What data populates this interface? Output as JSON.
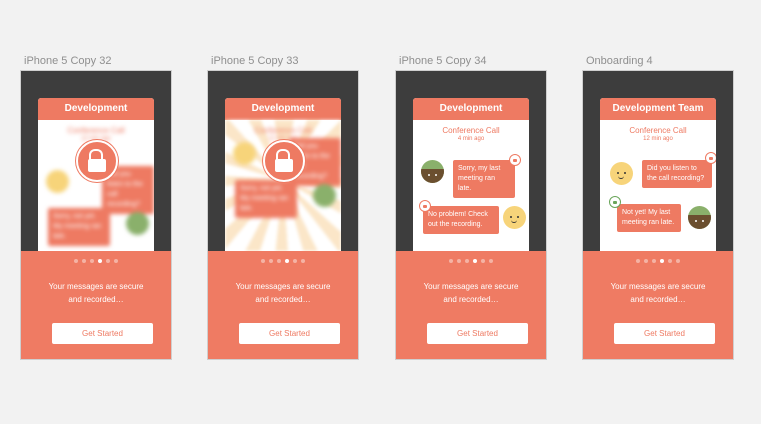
{
  "artboards": [
    {
      "label": "iPhone 5 Copy 32",
      "header": "Development",
      "conference": "Conference Call",
      "ago": "12 min ago",
      "bubble_top": "Did you listen to the call recording?",
      "bubble_bottom": "Sorry, not yet. My meeting ran late.",
      "tagline_line1": "Your messages are secure",
      "tagline_line2": "and recorded…",
      "button": "Get Started",
      "active_dot": 3
    },
    {
      "label": "iPhone 5 Copy 33",
      "header": "Development",
      "conference": "Conference Call",
      "ago": "12 min ago",
      "bubble_top": "Did you listen to the call recording?",
      "bubble_bottom": "Sorry, not yet. My meeting ran late.",
      "tagline_line1": "Your messages are secure",
      "tagline_line2": "and recorded…",
      "button": "Get Started",
      "active_dot": 3
    },
    {
      "label": "iPhone 5 Copy 34",
      "header": "Development",
      "conference": "Conference Call",
      "ago": "4 min ago",
      "bubble_top": "Sorry, my last meeting ran late.",
      "bubble_bottom": "No problem! Check out the recording.",
      "tagline_line1": "Your messages are secure",
      "tagline_line2": "and recorded…",
      "button": "Get Started",
      "active_dot": 3
    },
    {
      "label": "Onboarding 4",
      "header": "Development Team",
      "conference": "Conference Call",
      "ago": "12 min ago",
      "bubble_top": "Did you listen to the call recording?",
      "bubble_bottom": "Not yet! My last meeting ran late.",
      "tagline_line1": "Your messages are secure",
      "tagline_line2": "and recorded…",
      "button": "Get Started",
      "active_dot": 3
    }
  ],
  "dot_count": 6,
  "colors": {
    "accent": "#ee7a62",
    "dark_frame": "#3d3d3d",
    "canvas": "#f2f2f2",
    "lock_green": "#6aa55a"
  }
}
